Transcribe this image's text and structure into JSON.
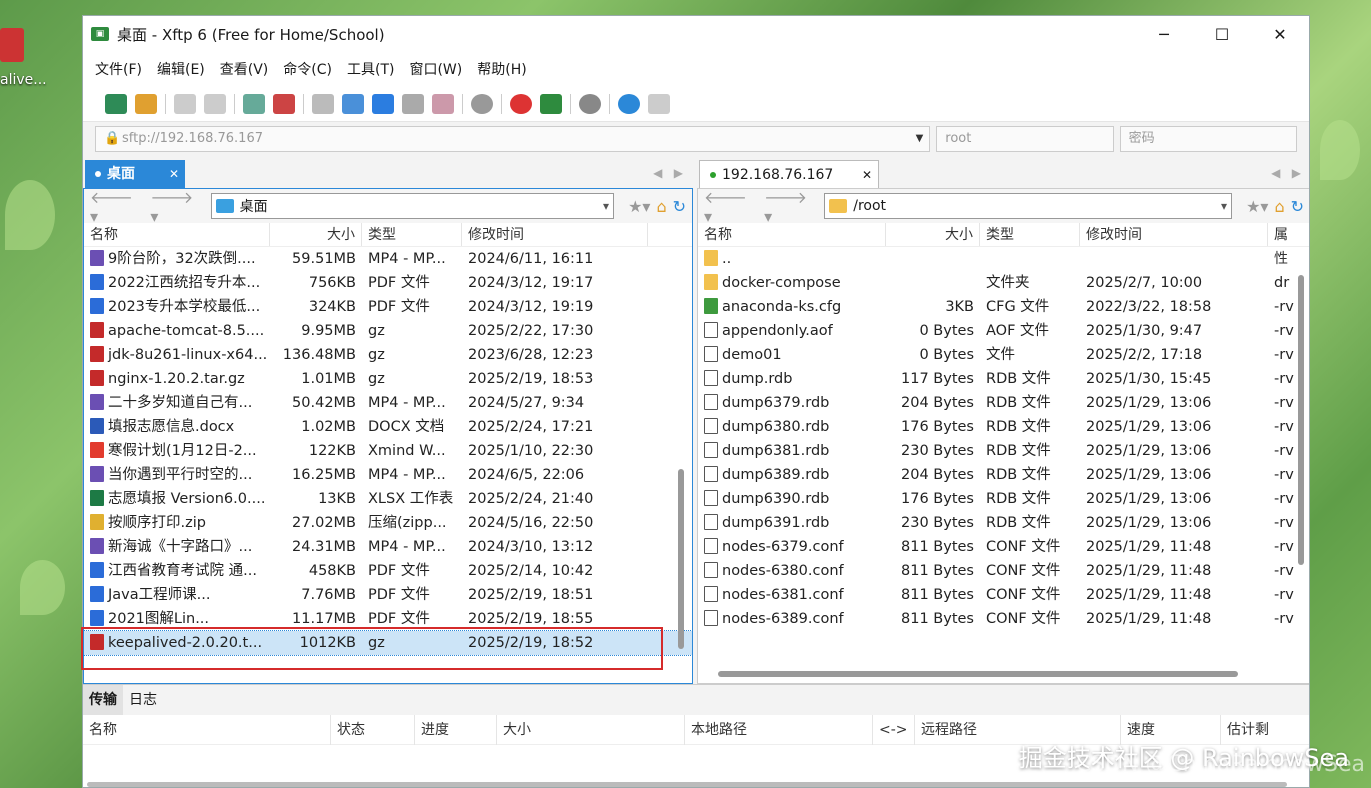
{
  "desktop": {
    "icon_label": "alive..."
  },
  "window": {
    "title": "桌面 - Xftp 6 (Free for Home/School)",
    "minimize": "─",
    "maximize": "☐",
    "close": "✕"
  },
  "menu": [
    "文件(F)",
    "编辑(E)",
    "查看(V)",
    "命令(C)",
    "工具(T)",
    "窗口(W)",
    "帮助(H)"
  ],
  "address": {
    "host": "sftp://192.168.76.167",
    "user_placeholder": "root",
    "password_placeholder": "密码"
  },
  "local": {
    "tab": "桌面",
    "path": "桌面",
    "headers": [
      "名称",
      "大小",
      "类型",
      "修改时间"
    ],
    "rows": [
      {
        "icon": "video",
        "name": "9阶台阶，32次跌倒....",
        "size": "59.51MB",
        "type": "MP4 - MP...",
        "date": "2024/6/11, 16:11"
      },
      {
        "icon": "pdf",
        "name": "2022江西统招专升本...",
        "size": "756KB",
        "type": "PDF 文件",
        "date": "2024/3/12, 19:17"
      },
      {
        "icon": "pdf",
        "name": "2023专升本学校最低...",
        "size": "324KB",
        "type": "PDF 文件",
        "date": "2024/3/12, 19:19"
      },
      {
        "icon": "gz",
        "name": "apache-tomcat-8.5....",
        "size": "9.95MB",
        "type": "gz",
        "date": "2025/2/22, 17:30"
      },
      {
        "icon": "gz",
        "name": "jdk-8u261-linux-x64...",
        "size": "136.48MB",
        "type": "gz",
        "date": "2023/6/28, 12:23"
      },
      {
        "icon": "gz",
        "name": "nginx-1.20.2.tar.gz",
        "size": "1.01MB",
        "type": "gz",
        "date": "2025/2/19, 18:53"
      },
      {
        "icon": "video",
        "name": "二十多岁知道自己有...",
        "size": "50.42MB",
        "type": "MP4 - MP...",
        "date": "2024/5/27, 9:34"
      },
      {
        "icon": "doc",
        "name": "填报志愿信息.docx",
        "size": "1.02MB",
        "type": "DOCX 文档",
        "date": "2025/2/24, 17:21"
      },
      {
        "icon": "xmind",
        "name": "寒假计划(1月12日-2...",
        "size": "122KB",
        "type": "Xmind W...",
        "date": "2025/1/10, 22:30"
      },
      {
        "icon": "video",
        "name": "当你遇到平行时空的...",
        "size": "16.25MB",
        "type": "MP4 - MP...",
        "date": "2024/6/5, 22:06"
      },
      {
        "icon": "xls",
        "name": "志愿填报 Version6.0....",
        "size": "13KB",
        "type": "XLSX 工作表",
        "date": "2025/2/24, 21:40"
      },
      {
        "icon": "zip",
        "name": "按顺序打印.zip",
        "size": "27.02MB",
        "type": "压缩(zipp...",
        "date": "2024/5/16, 22:50"
      },
      {
        "icon": "video",
        "name": "新海诚《十字路口》...",
        "size": "24.31MB",
        "type": "MP4 - MP...",
        "date": "2024/3/10, 13:12"
      },
      {
        "icon": "pdf",
        "name": "江西省教育考试院 通...",
        "size": "458KB",
        "type": "PDF 文件",
        "date": "2025/2/14, 10:42"
      },
      {
        "icon": "pdf",
        "name": "Java工程师课...",
        "size": "7.76MB",
        "type": "PDF 文件",
        "date": "2025/2/19, 18:51"
      },
      {
        "icon": "pdf",
        "name": "2021图解Lin...",
        "size": "11.17MB",
        "type": "PDF 文件",
        "date": "2025/2/19, 18:55"
      },
      {
        "icon": "gz",
        "name": "keepalived-2.0.20.t...",
        "size": "1012KB",
        "type": "gz",
        "date": "2025/2/19, 18:52"
      }
    ]
  },
  "remote": {
    "tab": "192.168.76.167",
    "path": "/root",
    "headers": [
      "名称",
      "大小",
      "类型",
      "修改时间",
      "属性"
    ],
    "rows": [
      {
        "icon": "folder",
        "name": "..",
        "size": "",
        "type": "",
        "date": "",
        "attr": ""
      },
      {
        "icon": "folder",
        "name": "docker-compose",
        "size": "",
        "type": "文件夹",
        "date": "2025/2/7, 10:00",
        "attr": "dr"
      },
      {
        "icon": "cfg",
        "name": "anaconda-ks.cfg",
        "size": "3KB",
        "type": "CFG 文件",
        "date": "2022/3/22, 18:58",
        "attr": "-rv"
      },
      {
        "icon": "file",
        "name": "appendonly.aof",
        "size": "0 Bytes",
        "type": "AOF 文件",
        "date": "2025/1/30, 9:47",
        "attr": "-rv"
      },
      {
        "icon": "file",
        "name": "demo01",
        "size": "0 Bytes",
        "type": "文件",
        "date": "2025/2/2, 17:18",
        "attr": "-rv"
      },
      {
        "icon": "file",
        "name": "dump.rdb",
        "size": "117 Bytes",
        "type": "RDB 文件",
        "date": "2025/1/30, 15:45",
        "attr": "-rv"
      },
      {
        "icon": "file",
        "name": "dump6379.rdb",
        "size": "204 Bytes",
        "type": "RDB 文件",
        "date": "2025/1/29, 13:06",
        "attr": "-rv"
      },
      {
        "icon": "file",
        "name": "dump6380.rdb",
        "size": "176 Bytes",
        "type": "RDB 文件",
        "date": "2025/1/29, 13:06",
        "attr": "-rv"
      },
      {
        "icon": "file",
        "name": "dump6381.rdb",
        "size": "230 Bytes",
        "type": "RDB 文件",
        "date": "2025/1/29, 13:06",
        "attr": "-rv"
      },
      {
        "icon": "file",
        "name": "dump6389.rdb",
        "size": "204 Bytes",
        "type": "RDB 文件",
        "date": "2025/1/29, 13:06",
        "attr": "-rv"
      },
      {
        "icon": "file",
        "name": "dump6390.rdb",
        "size": "176 Bytes",
        "type": "RDB 文件",
        "date": "2025/1/29, 13:06",
        "attr": "-rv"
      },
      {
        "icon": "file",
        "name": "dump6391.rdb",
        "size": "230 Bytes",
        "type": "RDB 文件",
        "date": "2025/1/29, 13:06",
        "attr": "-rv"
      },
      {
        "icon": "file",
        "name": "nodes-6379.conf",
        "size": "811 Bytes",
        "type": "CONF 文件",
        "date": "2025/1/29, 11:48",
        "attr": "-rv"
      },
      {
        "icon": "file",
        "name": "nodes-6380.conf",
        "size": "811 Bytes",
        "type": "CONF 文件",
        "date": "2025/1/29, 11:48",
        "attr": "-rv"
      },
      {
        "icon": "file",
        "name": "nodes-6381.conf",
        "size": "811 Bytes",
        "type": "CONF 文件",
        "date": "2025/1/29, 11:48",
        "attr": "-rv"
      },
      {
        "icon": "file",
        "name": "nodes-6389.conf",
        "size": "811 Bytes",
        "type": "CONF 文件",
        "date": "2025/1/29, 11:48",
        "attr": "-rv"
      }
    ]
  },
  "bottom": {
    "tabs": [
      "传输",
      "日志"
    ],
    "headers": [
      "名称",
      "状态",
      "进度",
      "大小",
      "本地路径",
      "<->",
      "远程路径",
      "速度",
      "估计剩"
    ]
  },
  "watermark": {
    "line1": "掘金技术社区 @ RainbowSea",
    "line2": "CSDN @ChinaRainbowSea"
  }
}
